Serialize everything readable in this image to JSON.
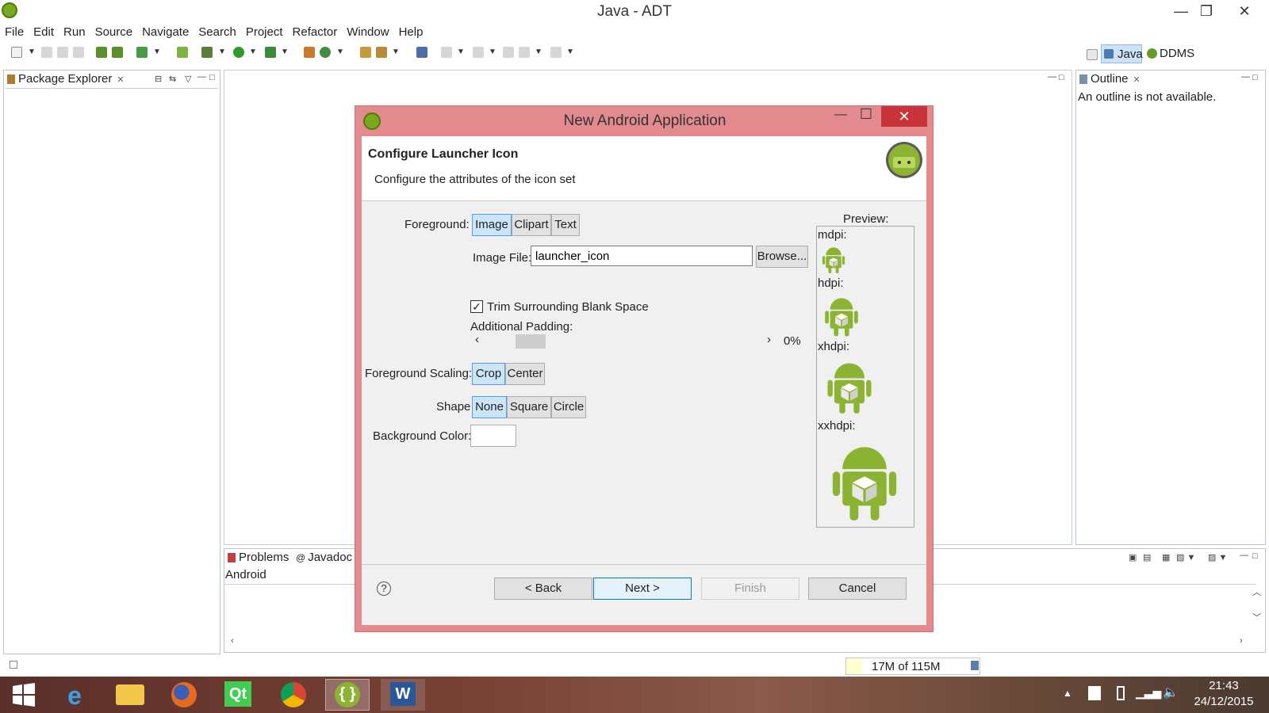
{
  "window": {
    "title": "Java - ADT",
    "minimize": "—",
    "maximize": "❐",
    "close": "✕"
  },
  "menu": [
    "File",
    "Edit",
    "Run",
    "Source",
    "Navigate",
    "Search",
    "Project",
    "Refactor",
    "Window",
    "Help"
  ],
  "perspectives": {
    "java": "Java",
    "ddms": "DDMS"
  },
  "package_explorer": {
    "title": "Package Explorer"
  },
  "outline": {
    "title": "Outline",
    "message": "An outline is not available."
  },
  "bottom_panel": {
    "tab_problems": "Problems",
    "tab_javadoc": "Javadoc",
    "content": "Android"
  },
  "status": {
    "memory": "17M of 115M"
  },
  "dialog": {
    "title": "New Android Application",
    "header_title": "Configure Launcher Icon",
    "header_subtitle": "Configure the attributes of the icon set",
    "foreground_label": "Foreground:",
    "foreground_options": [
      "Image",
      "Clipart",
      "Text"
    ],
    "image_file_label": "Image File:",
    "image_file_value": "launcher_icon",
    "browse_label": "Browse...",
    "trim_label": "Trim Surrounding Blank Space",
    "padding_label": "Additional Padding:",
    "padding_value": "0%",
    "padding_fraction": 0.0,
    "scaling_label": "Foreground Scaling:",
    "scaling_options": [
      "Crop",
      "Center"
    ],
    "shape_label": "Shape",
    "shape_options": [
      "None",
      "Square",
      "Circle"
    ],
    "bgcolor_label": "Background Color:",
    "preview_label": "Preview:",
    "preview_sizes": [
      "mdpi:",
      "hdpi:",
      "xhdpi:",
      "xxhdpi:"
    ],
    "back_label": "< Back",
    "next_label": "Next >",
    "finish_label": "Finish",
    "cancel_label": "Cancel",
    "help_glyph": "?"
  },
  "taskbar": {
    "time": "21:43",
    "date": "24/12/2015"
  },
  "colors": {
    "dialog_frame": "#e38a8f",
    "android_green": "#8cb432",
    "selected_segment": "#cce4f7",
    "close_red": "#c9343b"
  }
}
